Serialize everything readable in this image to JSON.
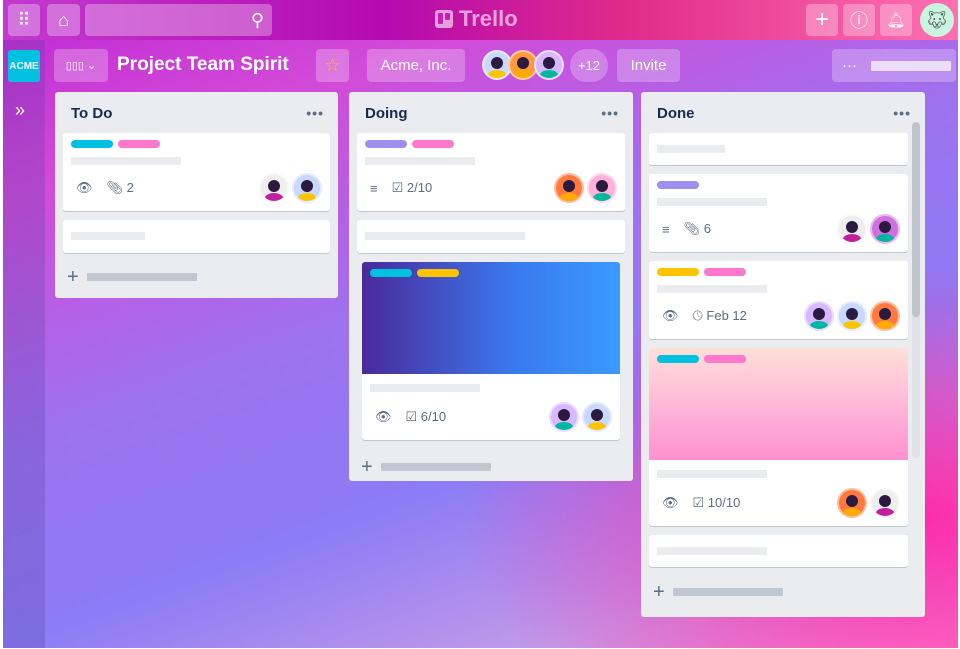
{
  "topbar": {
    "logo": "Trello",
    "apps_icon": "grid-icon",
    "home_icon": "home-icon",
    "search_icon": "search-icon",
    "create_icon": "plus-icon",
    "info_icon": "info-icon",
    "notif_icon": "bell-icon"
  },
  "sidebar": {
    "workspace_logo": "ACME",
    "expand_icon": "chevrons-right-icon"
  },
  "board": {
    "title": "Project Team Spirit",
    "workspace": "Acme, Inc.",
    "member_extra": "+12",
    "invite": "Invite",
    "menu": "···"
  },
  "colors": {
    "cyan": "#00c2e0",
    "pink": "#ff78cb",
    "purple": "#9f8fef",
    "yellow": "#ffc400"
  },
  "lists": [
    {
      "title": "To Do",
      "cards": [
        {
          "labels": [
            "#00c2e0",
            "#ff78cb"
          ],
          "attachments": "2",
          "watch": true
        },
        {}
      ]
    },
    {
      "title": "Doing",
      "cards": [
        {
          "labels": [
            "#9f8fef",
            "#ff78cb"
          ],
          "checklist": "2/10",
          "description": true
        },
        {},
        {
          "labels": [
            "#00c2e0",
            "#ffc400"
          ],
          "checklist": "6/10",
          "watch": true
        }
      ]
    },
    {
      "title": "Done",
      "cards": [
        {},
        {
          "labels": [
            "#9f8fef"
          ],
          "attachments": "6",
          "description": true
        },
        {
          "labels": [
            "#ffc400",
            "#ff78cb"
          ],
          "due": "Feb 12",
          "watch": true
        },
        {
          "labels": [
            "#00c2e0",
            "#ff78cb"
          ],
          "checklist": "10/10",
          "watch": true
        },
        {}
      ]
    }
  ]
}
